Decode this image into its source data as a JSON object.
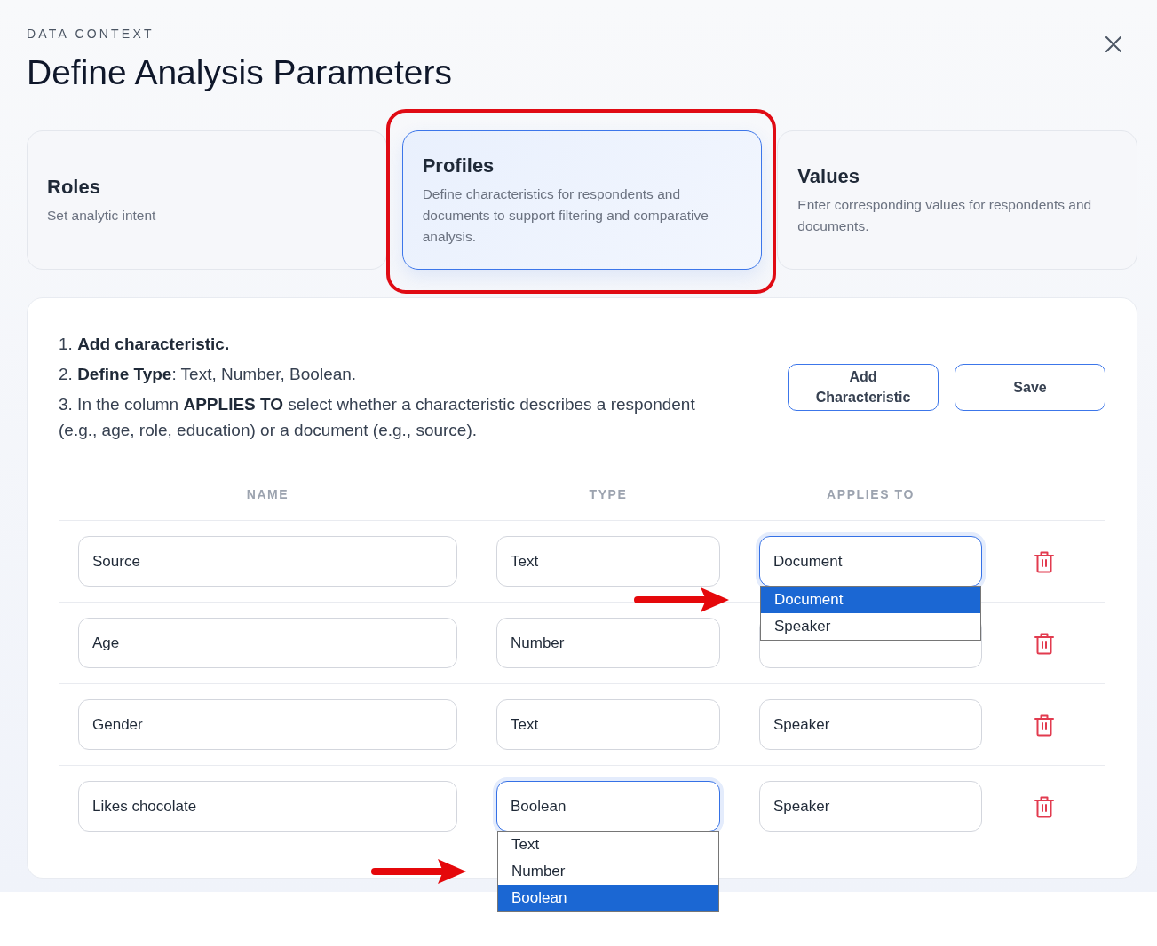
{
  "dialog": {
    "eyebrow": "DATA CONTEXT",
    "title": "Define Analysis Parameters"
  },
  "steps": [
    {
      "title": "Roles",
      "description": "Set analytic intent",
      "selected": false,
      "highlighted": false
    },
    {
      "title": "Profiles",
      "description": "Define characteristics for respondents and documents to support filtering and comparative analysis.",
      "selected": true,
      "highlighted": true
    },
    {
      "title": "Values",
      "description": "Enter corresponding values for respondents and documents.",
      "selected": false,
      "highlighted": false
    }
  ],
  "instructions": [
    "1. **Add characteristic.**",
    "2. **Define Type**: Text, Number, Boolean.",
    "3. In the column **APPLIES TO** select whether a characteristic describes a respondent (e.g., age, role, education) or a document (e.g., source)."
  ],
  "buttons": [
    "Add Characteristic",
    "Save"
  ],
  "table": {
    "columns": [
      "NAME",
      "TYPE",
      "APPLIES TO"
    ],
    "rows": [
      {
        "name": "Source",
        "type": {
          "value": "Text",
          "open": false
        },
        "applies_to": {
          "value": "Document",
          "open": true,
          "options": [
            {
              "label": "Document",
              "selected": true,
              "annotated": true
            },
            {
              "label": "Speaker",
              "selected": false,
              "annotated": false
            }
          ]
        }
      },
      {
        "name": "Age",
        "type": {
          "value": "Number",
          "open": false
        },
        "applies_to": {
          "open": false
        }
      },
      {
        "name": "Gender",
        "type": {
          "value": "Text",
          "open": false
        },
        "applies_to": {
          "value": "Speaker",
          "open": false
        }
      },
      {
        "name": "Likes chocolate",
        "type": {
          "value": "Boolean",
          "open": true,
          "options": [
            {
              "label": "Text",
              "selected": false,
              "annotated": false
            },
            {
              "label": "Number",
              "selected": false,
              "annotated": true
            },
            {
              "label": "Boolean",
              "selected": true,
              "annotated": false
            }
          ]
        },
        "applies_to": {
          "value": "Speaker",
          "open": false
        }
      }
    ]
  }
}
